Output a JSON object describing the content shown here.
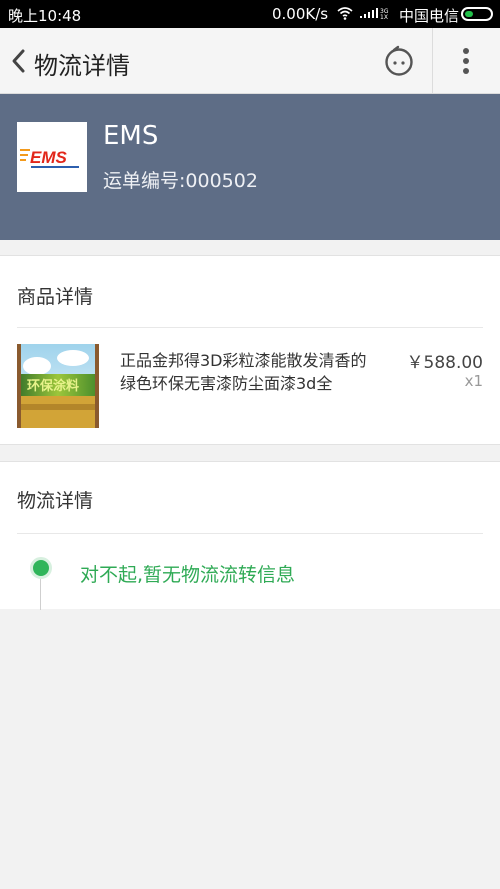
{
  "status_bar": {
    "time": "晚上10:48",
    "net_speed": "0.00K/s",
    "carrier": "中国电信",
    "icons": [
      "wifi-icon",
      "signal-icon",
      "battery-icon"
    ]
  },
  "nav": {
    "title": "物流详情",
    "back_icon": "chevron-left-icon",
    "robot_icon": "robot-face-icon",
    "more_icon": "vertical-dots-icon"
  },
  "shipment": {
    "carrier_name": "EMS",
    "waybill_label": "运单编号:000502",
    "logo_text": "EMS",
    "logo_color": "#e2261a"
  },
  "goods": {
    "section_title": "商品详情",
    "product_name": "正品金邦得3D彩粒漆能散发清香的绿色环保无害漆防尘面漆3d全",
    "price": "￥588.00",
    "quantity": "x1",
    "image_label": "环保涂料"
  },
  "logistics": {
    "section_title": "物流详情",
    "message": "对不起,暂无物流流转信息",
    "accent_color": "#2faa55"
  },
  "colors": {
    "header_bg": "#5e6d86",
    "page_bg": "#f2f2f2"
  }
}
